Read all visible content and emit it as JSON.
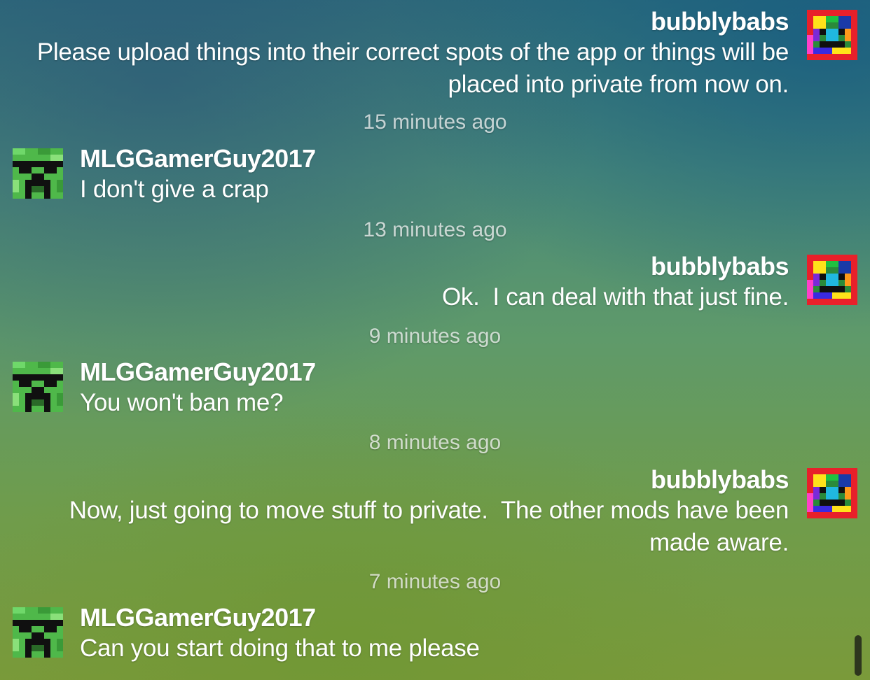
{
  "messages": [
    {
      "user": "bubblybabs",
      "side": "right",
      "text": "Please upload things into their correct spots of the app or things will be placed into private from now on.",
      "time": "15 minutes ago"
    },
    {
      "user": "MLGGamerGuy2017",
      "side": "left",
      "text": "I don't give a crap",
      "time": "13 minutes ago"
    },
    {
      "user": "bubblybabs",
      "side": "right",
      "text": "Ok.  I can deal with that just fine.",
      "time": "9 minutes ago"
    },
    {
      "user": "MLGGamerGuy2017",
      "side": "left",
      "text": "You won't ban me?",
      "time": "8 minutes ago"
    },
    {
      "user": "bubblybabs",
      "side": "right",
      "text": "Now, just going to move stuff to private.  The other mods have been made aware.",
      "time": "7 minutes ago"
    },
    {
      "user": "MLGGamerGuy2017",
      "side": "left",
      "text": "Can you start doing that to me please"
    }
  ],
  "avatars": {
    "bubblybabs": "rainbow-pixel-face-icon",
    "MLGGamerGuy2017": "creeper-face-icon"
  }
}
